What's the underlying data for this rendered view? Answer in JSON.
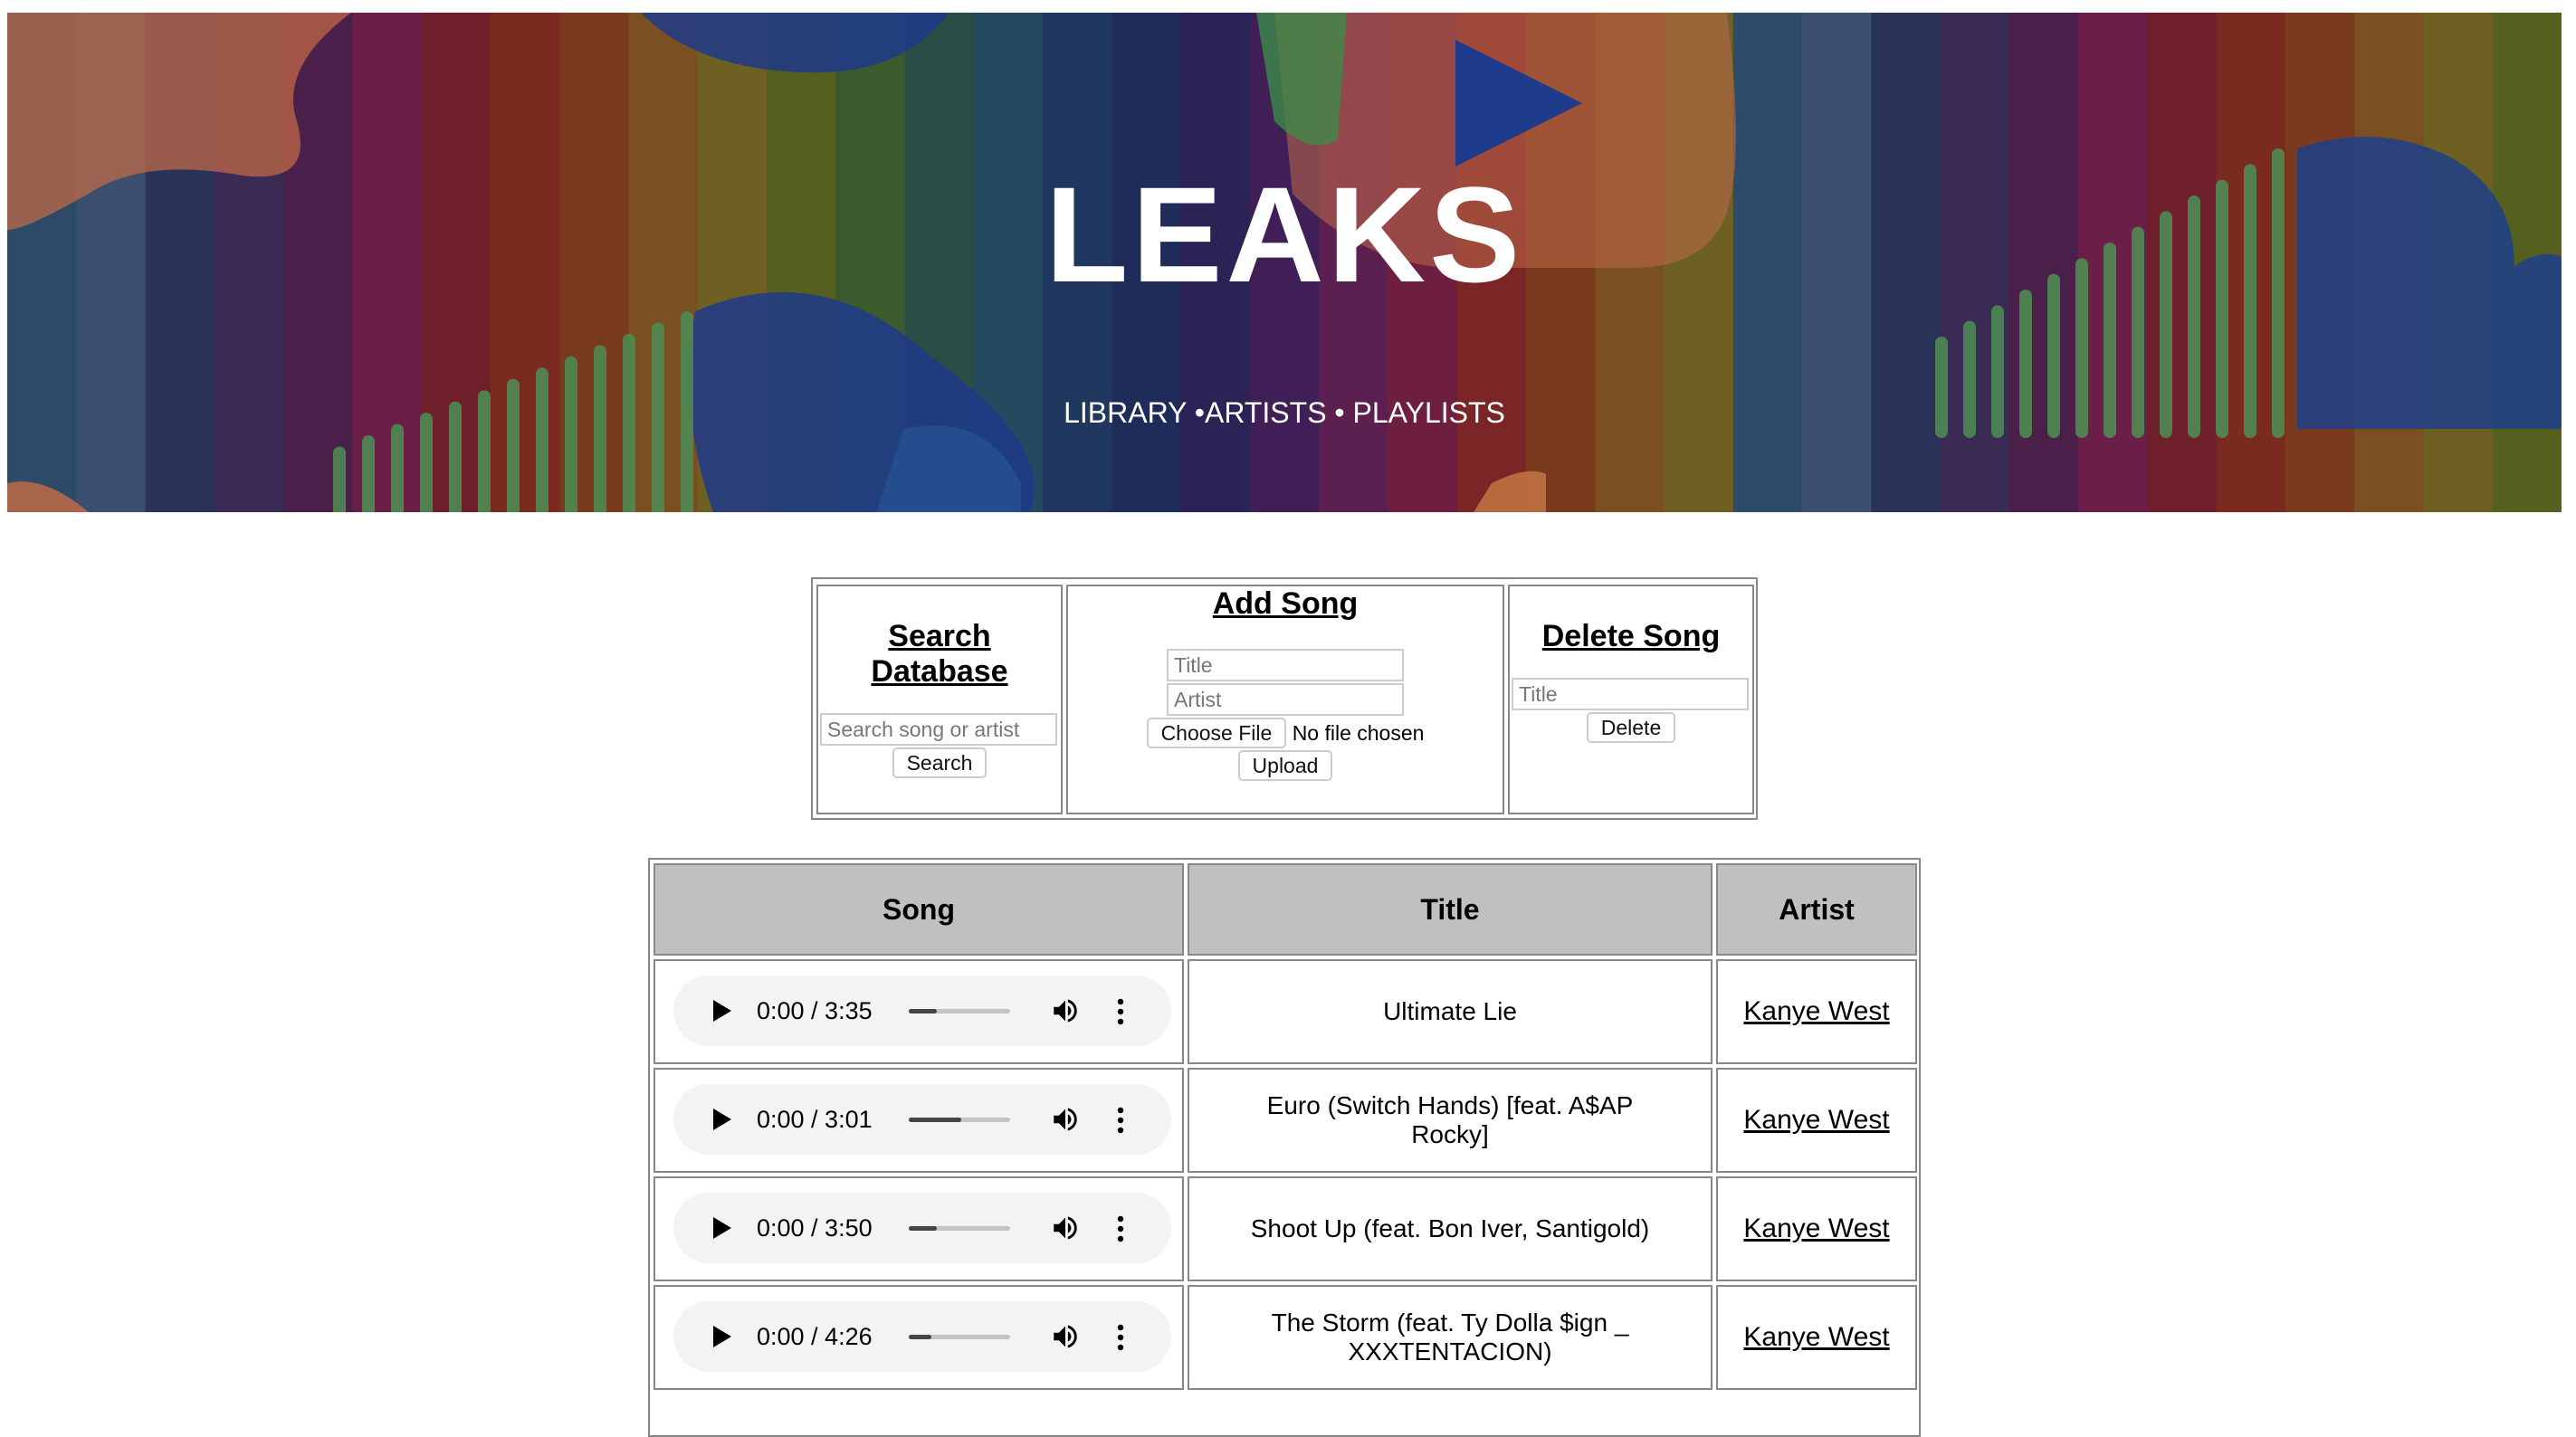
{
  "site": {
    "logo": "LEAKS",
    "nav": [
      {
        "label": "LIBRARY"
      },
      {
        "label": "ARTISTS"
      },
      {
        "label": "PLAYLISTS"
      }
    ],
    "nav_separator_1": " •",
    "nav_separator_2": " • "
  },
  "search": {
    "heading": "Search Database",
    "placeholder": "Search song or artist",
    "button": "Search"
  },
  "add_song": {
    "heading": "Add Song",
    "title_placeholder": "Title",
    "artist_placeholder": "Artist",
    "choose_file": "Choose File",
    "file_status": "No file chosen",
    "button": "Upload"
  },
  "delete_song": {
    "heading": "Delete Song",
    "title_placeholder": "Title",
    "button": "Delete"
  },
  "table": {
    "headers": [
      "Song",
      "Title",
      "Artist"
    ],
    "rows": [
      {
        "time": "0:00 / 3:35",
        "volume_fraction": 0.28,
        "title": "Ultimate Lie",
        "artist": "Kanye West"
      },
      {
        "time": "0:00 / 3:01",
        "volume_fraction": 0.52,
        "title": "Euro (Switch Hands) [feat. A$AP Rocky]",
        "artist": "Kanye West"
      },
      {
        "time": "0:00 / 3:50",
        "volume_fraction": 0.28,
        "title": "Shoot Up (feat. Bon Iver, Santigold)",
        "artist": "Kanye West"
      },
      {
        "time": "0:00 / 4:26",
        "volume_fraction": 0.22,
        "title": "The Storm (feat. Ty Dolla $ign _ XXXTENTACION)",
        "artist": "Kanye West"
      }
    ]
  },
  "colors": {
    "header_cell_bg": "#c0c0c0",
    "table_border": "#888888",
    "player_bg": "#f1f3f4"
  },
  "icons": {
    "play": "play-icon",
    "volume": "volume-icon",
    "more": "more-options-icon"
  }
}
